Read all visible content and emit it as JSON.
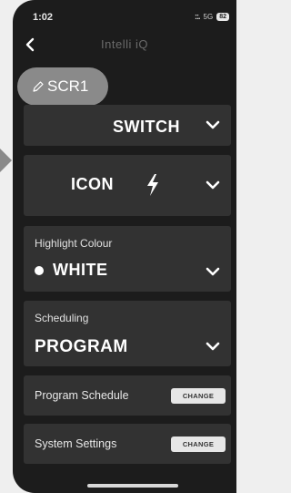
{
  "status_bar": {
    "time": "1:02",
    "signal": "::.",
    "network": "5G",
    "battery": "82"
  },
  "nav": {
    "title": "Intelli iQ",
    "back_icon": "chevron-left-icon"
  },
  "device_name": {
    "label": "SCR1",
    "icon": "pencil-icon"
  },
  "switch_card": {
    "label": "SWITCH",
    "icon": "chevron-down-icon"
  },
  "icon_card": {
    "label": "ICON",
    "selected_icon": "lightning-bolt-icon",
    "icon": "chevron-down-icon"
  },
  "highlight": {
    "label": "Highlight Colour",
    "value": "WHITE",
    "swatch_color": "#ffffff"
  },
  "scheduling": {
    "label": "Scheduling",
    "value": "PROGRAM"
  },
  "program_schedule": {
    "label": "Program Schedule",
    "button": "CHANGE"
  },
  "system_settings": {
    "label": "System Settings",
    "button": "CHANGE"
  },
  "colors": {
    "background": "#1c1c1c",
    "card": "#323232",
    "pill": "#8a8a8a"
  }
}
